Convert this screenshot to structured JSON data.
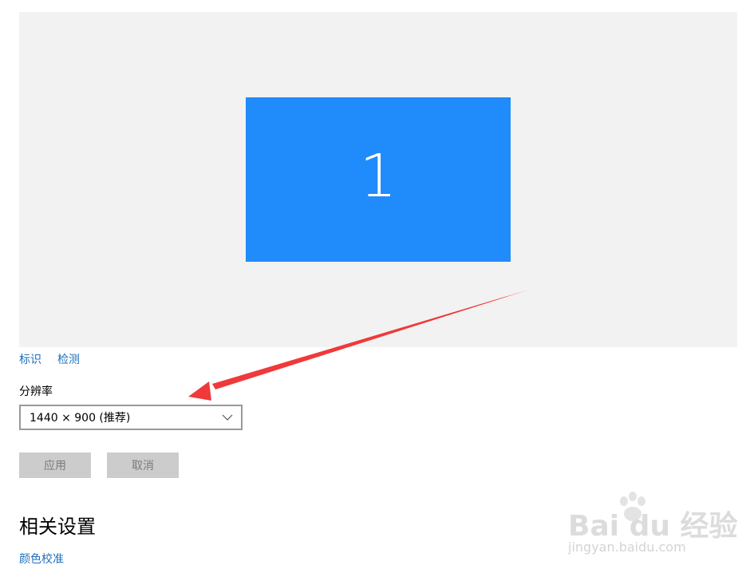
{
  "display_preview": {
    "monitor_number": "1",
    "tile_color": "#208bfa",
    "background_color": "#f2f2f2"
  },
  "links": {
    "identify": "标识",
    "detect": "检测"
  },
  "resolution": {
    "label": "分辨率",
    "selected": "1440 × 900 (推荐)"
  },
  "buttons": {
    "apply": "应用",
    "cancel": "取消"
  },
  "related_settings": {
    "heading": "相关设置",
    "color_calibration": "颜色校准"
  },
  "annotation": {
    "arrow_color": "#f0393a"
  },
  "watermark": {
    "logo_text": "Bai du 经验",
    "url": "jingyan.baidu.com"
  },
  "icons": {
    "dropdown": "chevron-down-icon",
    "arrow": "red-arrow-annotation",
    "watermark_logo": "baidu-paw-logo"
  }
}
